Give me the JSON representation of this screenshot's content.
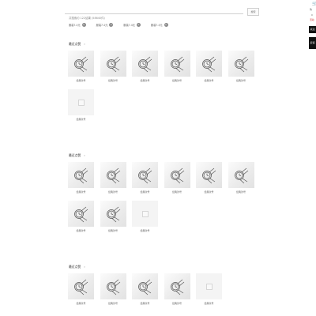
{
  "search": {
    "button_label": "搜索",
    "hint": "共搜索约 122结果 (58640件)"
  },
  "filters": [
    "服装7.4元",
    "服装7.4元",
    "服装7.4元",
    "服装7.4元"
  ],
  "sections": [
    {
      "title": "最近点赞",
      "items": [
        "经典款号",
        "经典款号",
        "经典款号",
        "经典款号",
        "经典款号",
        "经典款号",
        "经典款号"
      ]
    },
    {
      "title": "最近点赞",
      "items": [
        "经典款号",
        "经典款号",
        "经典款号",
        "经典款号",
        "经典款号",
        "经典款号",
        "经典款号",
        "经典款号",
        "经典款号"
      ]
    },
    {
      "title": "最近点赞",
      "items": [
        "经典款号",
        "经典款号",
        "经典款号",
        "经典款号",
        "经典款号"
      ]
    }
  ],
  "sidebar": {
    "cart_label": "购",
    "count": "0",
    "red_label": "活动",
    "black_label_1": "关注",
    "black_label_2": "反馈"
  },
  "colors": {
    "accent_red": "#d02020",
    "dark": "#111111"
  }
}
